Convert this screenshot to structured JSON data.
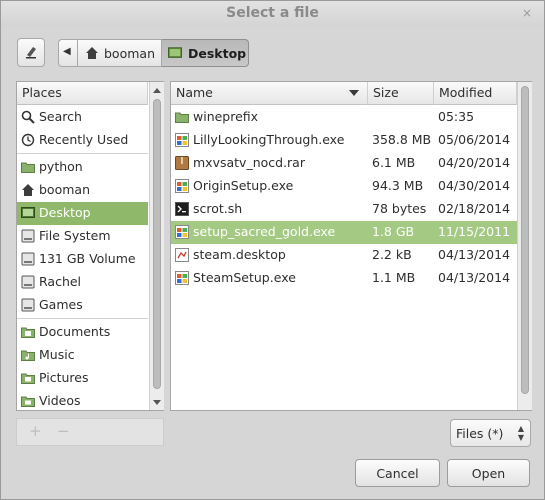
{
  "window": {
    "title": "Select a file",
    "close_glyph": "×"
  },
  "toolbar": {
    "edit_icon": "pencil-icon",
    "back_glyph": "◀",
    "crumbs": [
      {
        "label": "booman",
        "icon": "home-icon"
      },
      {
        "label": "Desktop",
        "icon": "desktop-icon",
        "active": true
      }
    ]
  },
  "places": {
    "header": "Places",
    "items": [
      {
        "label": "Search",
        "icon": "search-icon"
      },
      {
        "label": "Recently Used",
        "icon": "clock-icon"
      },
      {
        "label": "python",
        "icon": "folder-icon"
      },
      {
        "label": "booman",
        "icon": "home-icon"
      },
      {
        "label": "Desktop",
        "icon": "desktop-icon",
        "selected": true
      },
      {
        "label": "File System",
        "icon": "drive-icon"
      },
      {
        "label": "131 GB Volume",
        "icon": "drive-icon"
      },
      {
        "label": "Rachel",
        "icon": "drive-icon"
      },
      {
        "label": "Games",
        "icon": "drive-icon"
      },
      {
        "label": "Documents",
        "icon": "documents-folder-icon"
      },
      {
        "label": "Music",
        "icon": "music-folder-icon"
      },
      {
        "label": "Pictures",
        "icon": "pictures-folder-icon"
      },
      {
        "label": "Videos",
        "icon": "videos-folder-icon"
      }
    ],
    "add_glyph": "+",
    "remove_glyph": "−"
  },
  "files": {
    "columns": {
      "name": "Name",
      "size": "Size",
      "modified": "Modified"
    },
    "rows": [
      {
        "name": "wineprefix",
        "size": "",
        "modified": "05:35",
        "icon": "folder-icon"
      },
      {
        "name": "LillyLookingThrough.exe",
        "size": "358.8 MB",
        "modified": "05/06/2014",
        "icon": "exe-icon"
      },
      {
        "name": "mxvsatv_nocd.rar",
        "size": "6.1 MB",
        "modified": "04/20/2014",
        "icon": "archive-icon"
      },
      {
        "name": "OriginSetup.exe",
        "size": "94.3 MB",
        "modified": "04/30/2014",
        "icon": "exe-icon"
      },
      {
        "name": "scrot.sh",
        "size": "78 bytes",
        "modified": "02/18/2014",
        "icon": "script-icon"
      },
      {
        "name": "setup_sacred_gold.exe",
        "size": "1.8 GB",
        "modified": "11/15/2011",
        "icon": "exe-icon",
        "selected": true
      },
      {
        "name": "steam.desktop",
        "size": "2.2 kB",
        "modified": "04/13/2014",
        "icon": "desktop-file-icon"
      },
      {
        "name": "SteamSetup.exe",
        "size": "1.1 MB",
        "modified": "04/13/2014",
        "icon": "exe-icon"
      }
    ]
  },
  "filter": {
    "value": "Files (*)",
    "spin_up": "▲",
    "spin_down": "▼"
  },
  "buttons": {
    "cancel": "Cancel",
    "open": "Open"
  },
  "colors": {
    "selection_green": "#8fb86a",
    "folder_green": "#8ab26a"
  }
}
